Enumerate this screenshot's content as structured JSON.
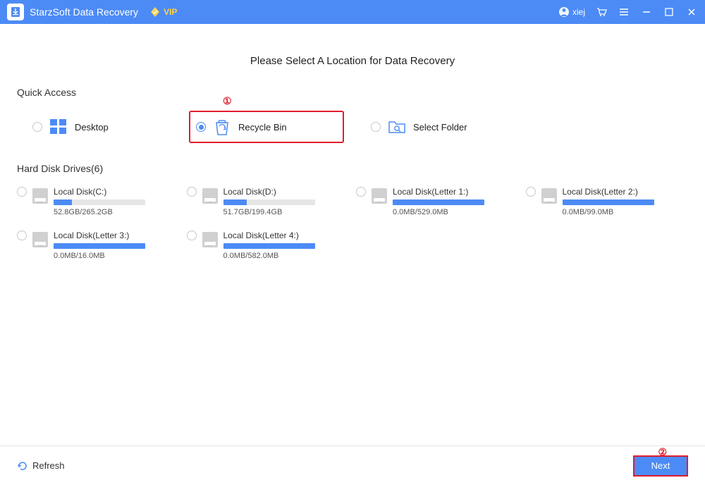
{
  "titlebar": {
    "app_name": "StarzSoft Data Recovery",
    "vip_label": "VIP",
    "username": "xiej"
  },
  "headline": "Please Select A Location for Data Recovery",
  "sections": {
    "quick_access_title": "Quick Access",
    "drives_title": "Hard Disk Drives(6)"
  },
  "quick_access": {
    "desktop": "Desktop",
    "recycle_bin": "Recycle Bin",
    "select_folder": "Select Folder"
  },
  "drives": [
    {
      "name": "Local Disk(C:)",
      "used": "52.8GB/265.2GB",
      "pct": 20
    },
    {
      "name": "Local Disk(D:)",
      "used": "51.7GB/199.4GB",
      "pct": 26
    },
    {
      "name": "Local Disk(Letter 1:)",
      "used": "0.0MB/529.0MB",
      "pct": 100
    },
    {
      "name": "Local Disk(Letter 2:)",
      "used": "0.0MB/99.0MB",
      "pct": 100
    },
    {
      "name": "Local Disk(Letter 3:)",
      "used": "0.0MB/16.0MB",
      "pct": 100
    },
    {
      "name": "Local Disk(Letter 4:)",
      "used": "0.0MB/582.0MB",
      "pct": 100
    }
  ],
  "footer": {
    "refresh": "Refresh",
    "next": "Next"
  },
  "callouts": {
    "one": "①",
    "two": "②"
  }
}
